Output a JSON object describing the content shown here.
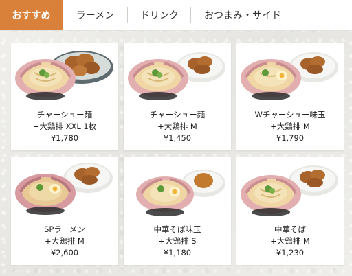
{
  "tabs": [
    {
      "label": "おすすめ",
      "active": true
    },
    {
      "label": "ラーメン",
      "active": false
    },
    {
      "label": "ドリンク",
      "active": false
    },
    {
      "label": "おつまみ・サイド",
      "active": false
    }
  ],
  "colors": {
    "accent": "#d9813b",
    "card": "#ffffff"
  },
  "menu_items": [
    {
      "name": "チャーシュー麺",
      "option": "+大鶏排 XXL 1枚",
      "price": "¥1,780",
      "image": "ramen-with-chicken-image"
    },
    {
      "name": "チャーシュー麺",
      "option": "+大鶏排 M",
      "price": "¥1,450",
      "image": "ramen-with-chicken-image"
    },
    {
      "name": "Wチャーシュー味玉",
      "option": "+大鶏排 M",
      "price": "¥1,790",
      "image": "ramen-with-chicken-image"
    },
    {
      "name": "SPラーメン",
      "option": "+大鶏排 M",
      "price": "¥2,600",
      "image": "ramen-with-chicken-image"
    },
    {
      "name": "中華そば味玉",
      "option": "+大鶏排 S",
      "price": "¥1,180",
      "image": "ramen-with-chicken-image"
    },
    {
      "name": "中華そば",
      "option": "+大鶏排 M",
      "price": "¥1,230",
      "image": "ramen-with-chicken-image"
    }
  ]
}
